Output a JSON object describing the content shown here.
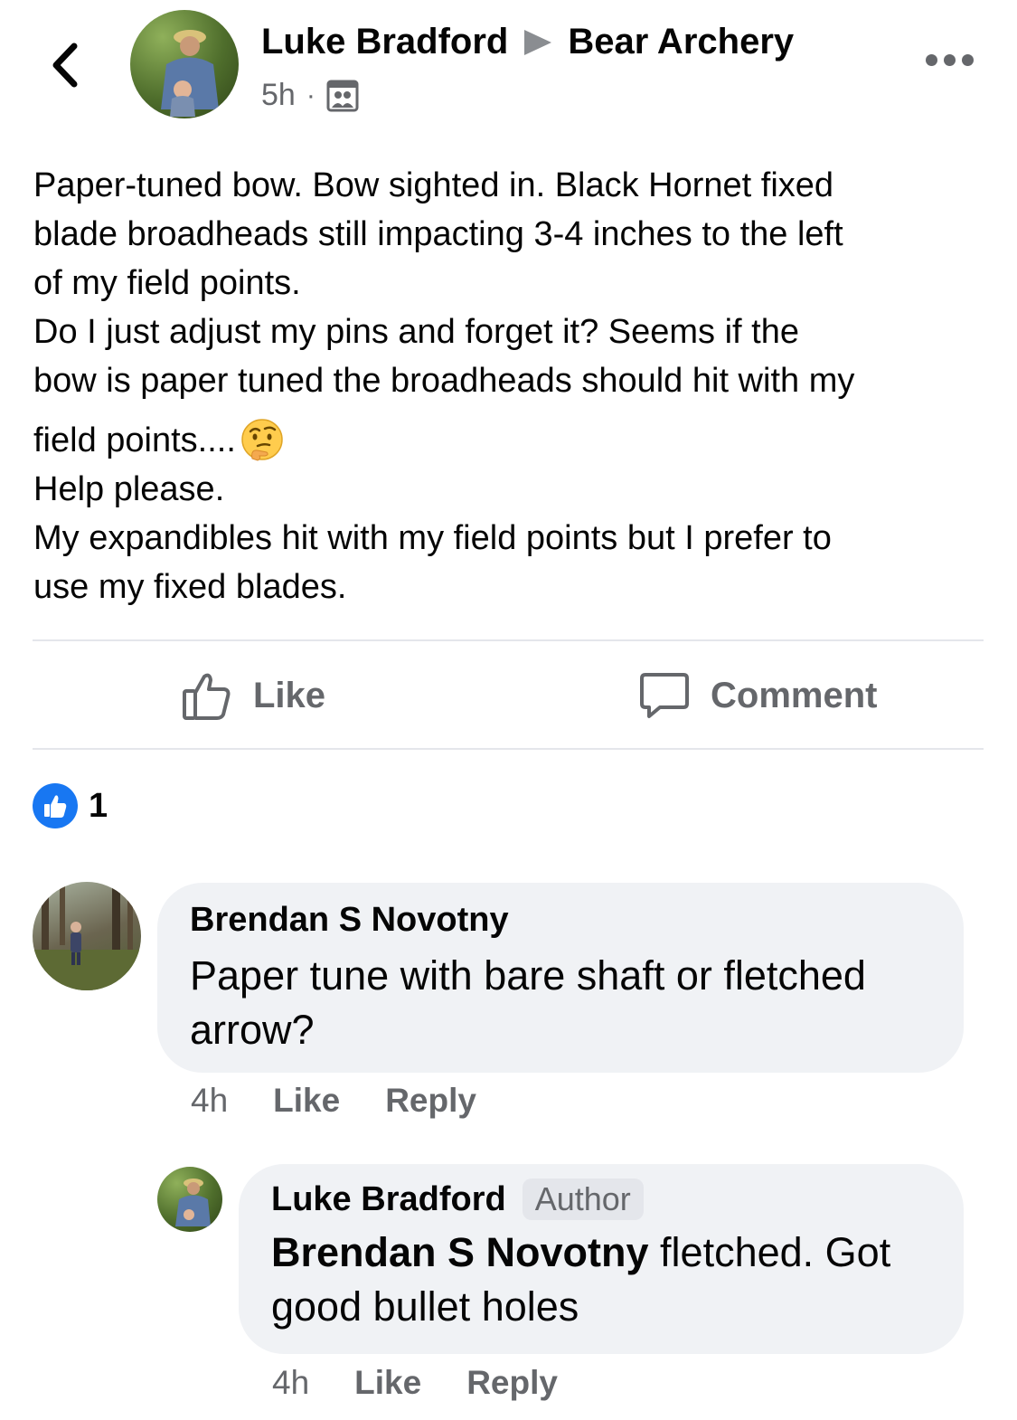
{
  "post": {
    "author": "Luke Bradford",
    "group": "Bear Archery",
    "time": "5h",
    "privacy_icon": "group-audience-icon",
    "more_icon": "more-options-icon",
    "body_lines": [
      "Paper-tuned bow. Bow sighted in. Black Hornet fixed",
      "blade broadheads still impacting 3-4 inches to the left",
      "of my field points.",
      "Do I just adjust my pins and forget it? Seems if the",
      "bow is paper tuned the broadheads should hit with my",
      "field points....",
      "Help please.",
      "My expandibles hit with my field points but I prefer to",
      "use my fixed blades."
    ],
    "emoji": "thinking-face-emoji"
  },
  "actions": {
    "like_label": "Like",
    "comment_label": "Comment"
  },
  "reactions": {
    "count": "1",
    "type": "like"
  },
  "comments": [
    {
      "author": "Brendan S Novotny",
      "text_lines": [
        "Paper tune with bare shaft or fletched",
        "arrow?"
      ],
      "time": "4h",
      "like_label": "Like",
      "reply_label": "Reply"
    },
    {
      "author": "Luke Bradford",
      "badge": "Author",
      "mention": "Brendan S Novotny",
      "text_after_mention": " fletched. Got",
      "text_line2": "good bullet holes",
      "time": "4h",
      "like_label": "Like",
      "reply_label": "Reply"
    }
  ],
  "colors": {
    "secondary_text": "#65676b",
    "bubble_bg": "#f0f2f5",
    "like_blue": "#1877f2",
    "divider": "#e4e6eb"
  }
}
